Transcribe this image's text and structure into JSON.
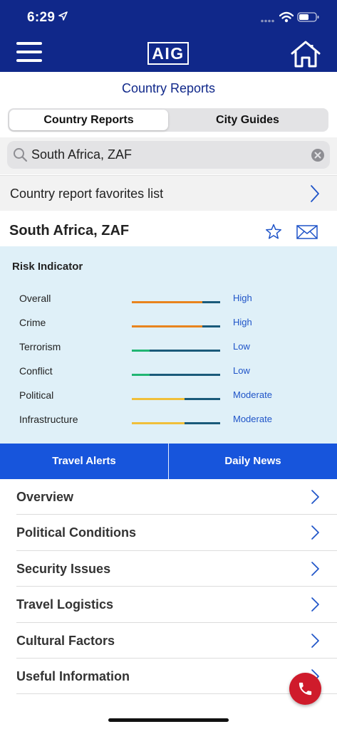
{
  "status_bar": {
    "time": "6:29"
  },
  "header": {
    "logo_text": "AIG",
    "menu_icon": "hamburger-icon",
    "home_icon": "home-icon"
  },
  "page_title": "Country Reports",
  "segments": [
    {
      "label": "Country Reports",
      "active": true
    },
    {
      "label": "City Guides",
      "active": false
    }
  ],
  "search": {
    "value": "South Africa, ZAF"
  },
  "favorites": {
    "label": "Country report favorites list"
  },
  "country": {
    "name": "South Africa, ZAF"
  },
  "risk": {
    "title": "Risk Indicator",
    "colors": {
      "high": "#e8841e",
      "low": "#21b573",
      "moderate": "#f0bf3a",
      "track": "#1a5a7a"
    },
    "rows": [
      {
        "label": "Overall",
        "level": "High",
        "fill": 0.8,
        "color": "#e8841e"
      },
      {
        "label": "Crime",
        "level": "High",
        "fill": 0.8,
        "color": "#e8841e"
      },
      {
        "label": "Terrorism",
        "level": "Low",
        "fill": 0.2,
        "color": "#21b573"
      },
      {
        "label": "Conflict",
        "level": "Low",
        "fill": 0.2,
        "color": "#21b573"
      },
      {
        "label": "Political",
        "level": "Moderate",
        "fill": 0.6,
        "color": "#f0bf3a"
      },
      {
        "label": "Infrastructure",
        "level": "Moderate",
        "fill": 0.6,
        "color": "#f0bf3a"
      }
    ]
  },
  "tabs": [
    {
      "label": "Travel Alerts"
    },
    {
      "label": "Daily News"
    }
  ],
  "menu": [
    {
      "label": "Overview"
    },
    {
      "label": "Political Conditions"
    },
    {
      "label": "Security Issues"
    },
    {
      "label": "Travel Logistics"
    },
    {
      "label": "Cultural Factors"
    },
    {
      "label": "Useful Information"
    }
  ],
  "brand_colors": {
    "header": "#10288a",
    "tabbar": "#1755dc",
    "call": "#cf1b2b",
    "panel": "#dff0f8"
  }
}
